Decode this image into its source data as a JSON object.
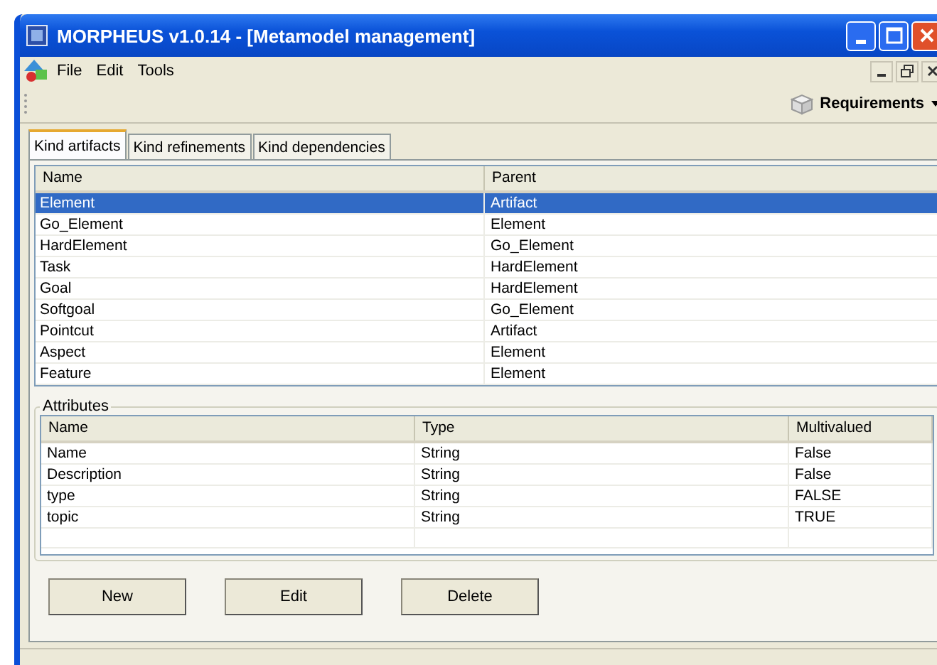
{
  "window": {
    "title": "MORPHEUS v1.0.14 - [Metamodel management]"
  },
  "menu": [
    "File",
    "Edit",
    "Tools"
  ],
  "toolbar": {
    "project": "Requirements"
  },
  "tabs": [
    {
      "label": "Kind artifacts",
      "selected": true
    },
    {
      "label": "Kind refinements",
      "selected": false
    },
    {
      "label": "Kind dependencies",
      "selected": false
    }
  ],
  "artifacts": {
    "columns": [
      "Name",
      "Parent"
    ],
    "rows": [
      {
        "name": "Element",
        "parent": "Artifact",
        "selected": true
      },
      {
        "name": "Go_Element",
        "parent": "Element",
        "selected": false
      },
      {
        "name": "HardElement",
        "parent": "Go_Element",
        "selected": false
      },
      {
        "name": "Task",
        "parent": "HardElement",
        "selected": false
      },
      {
        "name": "Goal",
        "parent": "HardElement",
        "selected": false
      },
      {
        "name": "Softgoal",
        "parent": "Go_Element",
        "selected": false
      },
      {
        "name": "Pointcut",
        "parent": "Artifact",
        "selected": false
      },
      {
        "name": "Aspect",
        "parent": "Element",
        "selected": false
      },
      {
        "name": "Feature",
        "parent": "Element",
        "selected": false
      }
    ]
  },
  "attributes": {
    "title": "Attributes",
    "columns": [
      "Name",
      "Type",
      "Multivalued"
    ],
    "rows": [
      [
        "Name",
        "String",
        "False"
      ],
      [
        "Description",
        "String",
        "False"
      ],
      [
        "type",
        "String",
        "FALSE"
      ],
      [
        "topic",
        "String",
        "TRUE"
      ]
    ]
  },
  "buttons": [
    "New",
    "Edit",
    "Delete"
  ]
}
